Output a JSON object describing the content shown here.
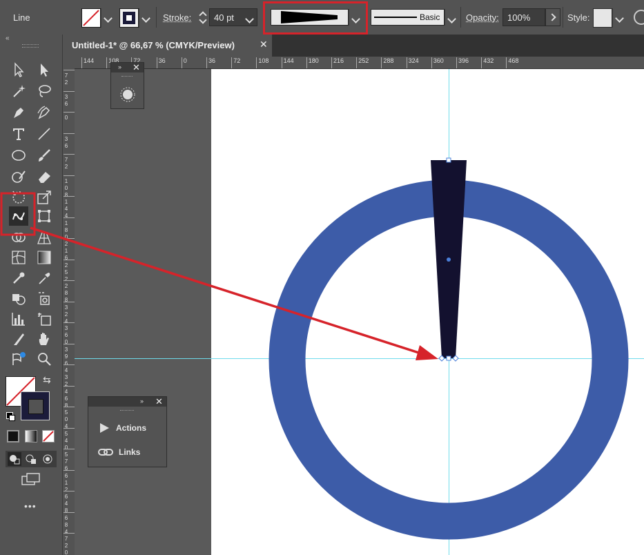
{
  "control_bar": {
    "mode_label": "Line",
    "stroke_label": "Stroke:",
    "stroke_weight": "40 pt",
    "brush_label": "Basic",
    "opacity_label": "Opacity:",
    "opacity_value": "100%",
    "style_label": "Style:",
    "colors": {
      "stroke_swatch": "#1b1b3a",
      "highlight": "#d6232a"
    }
  },
  "tabs": [
    {
      "label": "Untitled-1* @ 66,67 % (CMYK/Preview)",
      "close": "✕"
    }
  ],
  "rulers": {
    "horizontal": [
      "144",
      "108",
      "72",
      "36",
      "0",
      "36",
      "72",
      "108",
      "144",
      "180",
      "216",
      "252",
      "288",
      "324",
      "360",
      "396",
      "432",
      "468"
    ],
    "vertical": [
      "72",
      "36",
      "0",
      "36",
      "72",
      "108",
      "144",
      "180",
      "216",
      "252",
      "288",
      "324",
      "360",
      "396",
      "432",
      "468",
      "504",
      "540",
      "576",
      "612",
      "648",
      "684",
      "720"
    ]
  },
  "panels": {
    "mini": {
      "expand": "»",
      "close": "✕"
    },
    "actions_links": {
      "expand": "»",
      "close": "✕",
      "items": [
        {
          "label": "Actions",
          "icon": "play-icon"
        },
        {
          "label": "Links",
          "icon": "link-icon"
        }
      ]
    }
  },
  "tools_more": "•••",
  "canvas": {
    "ring_color": "#3d5ca8",
    "needle_color": "#13112f",
    "guide_color": "#6fdcec",
    "arrow_color": "#d6232a"
  }
}
